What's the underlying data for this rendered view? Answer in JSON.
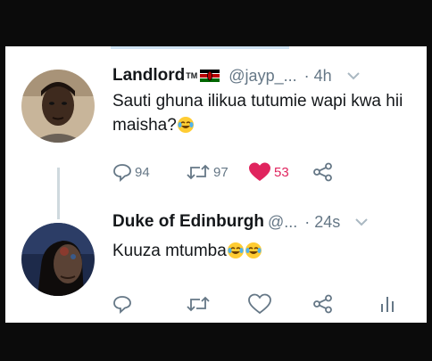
{
  "tweets": [
    {
      "display_name": "Landlord",
      "tm_mark": "TM",
      "handle": "@jayp_...",
      "time": "· 4h",
      "text": "Sauti ghuna ilikua tutumie wapi kwa hii maisha?",
      "emoji": "face-with-tears-of-joy",
      "actions": {
        "replies": "94",
        "retweets": "97",
        "likes": "53",
        "liked": true
      }
    },
    {
      "display_name": "Duke of Edinburgh",
      "handle": "@...",
      "time": "· 24s",
      "text": "Kuuza mtumba",
      "emoji": "face-with-tears-of-joy",
      "emoji_count": 2
    }
  ],
  "colors": {
    "like_red": "#e0245e",
    "meta_gray": "#657786",
    "text_dark": "#14171a"
  },
  "icons": [
    "reply-icon",
    "retweet-icon",
    "heart-icon",
    "share-icon",
    "analytics-icon",
    "chevron-down-icon",
    "kenya-flag-icon"
  ]
}
